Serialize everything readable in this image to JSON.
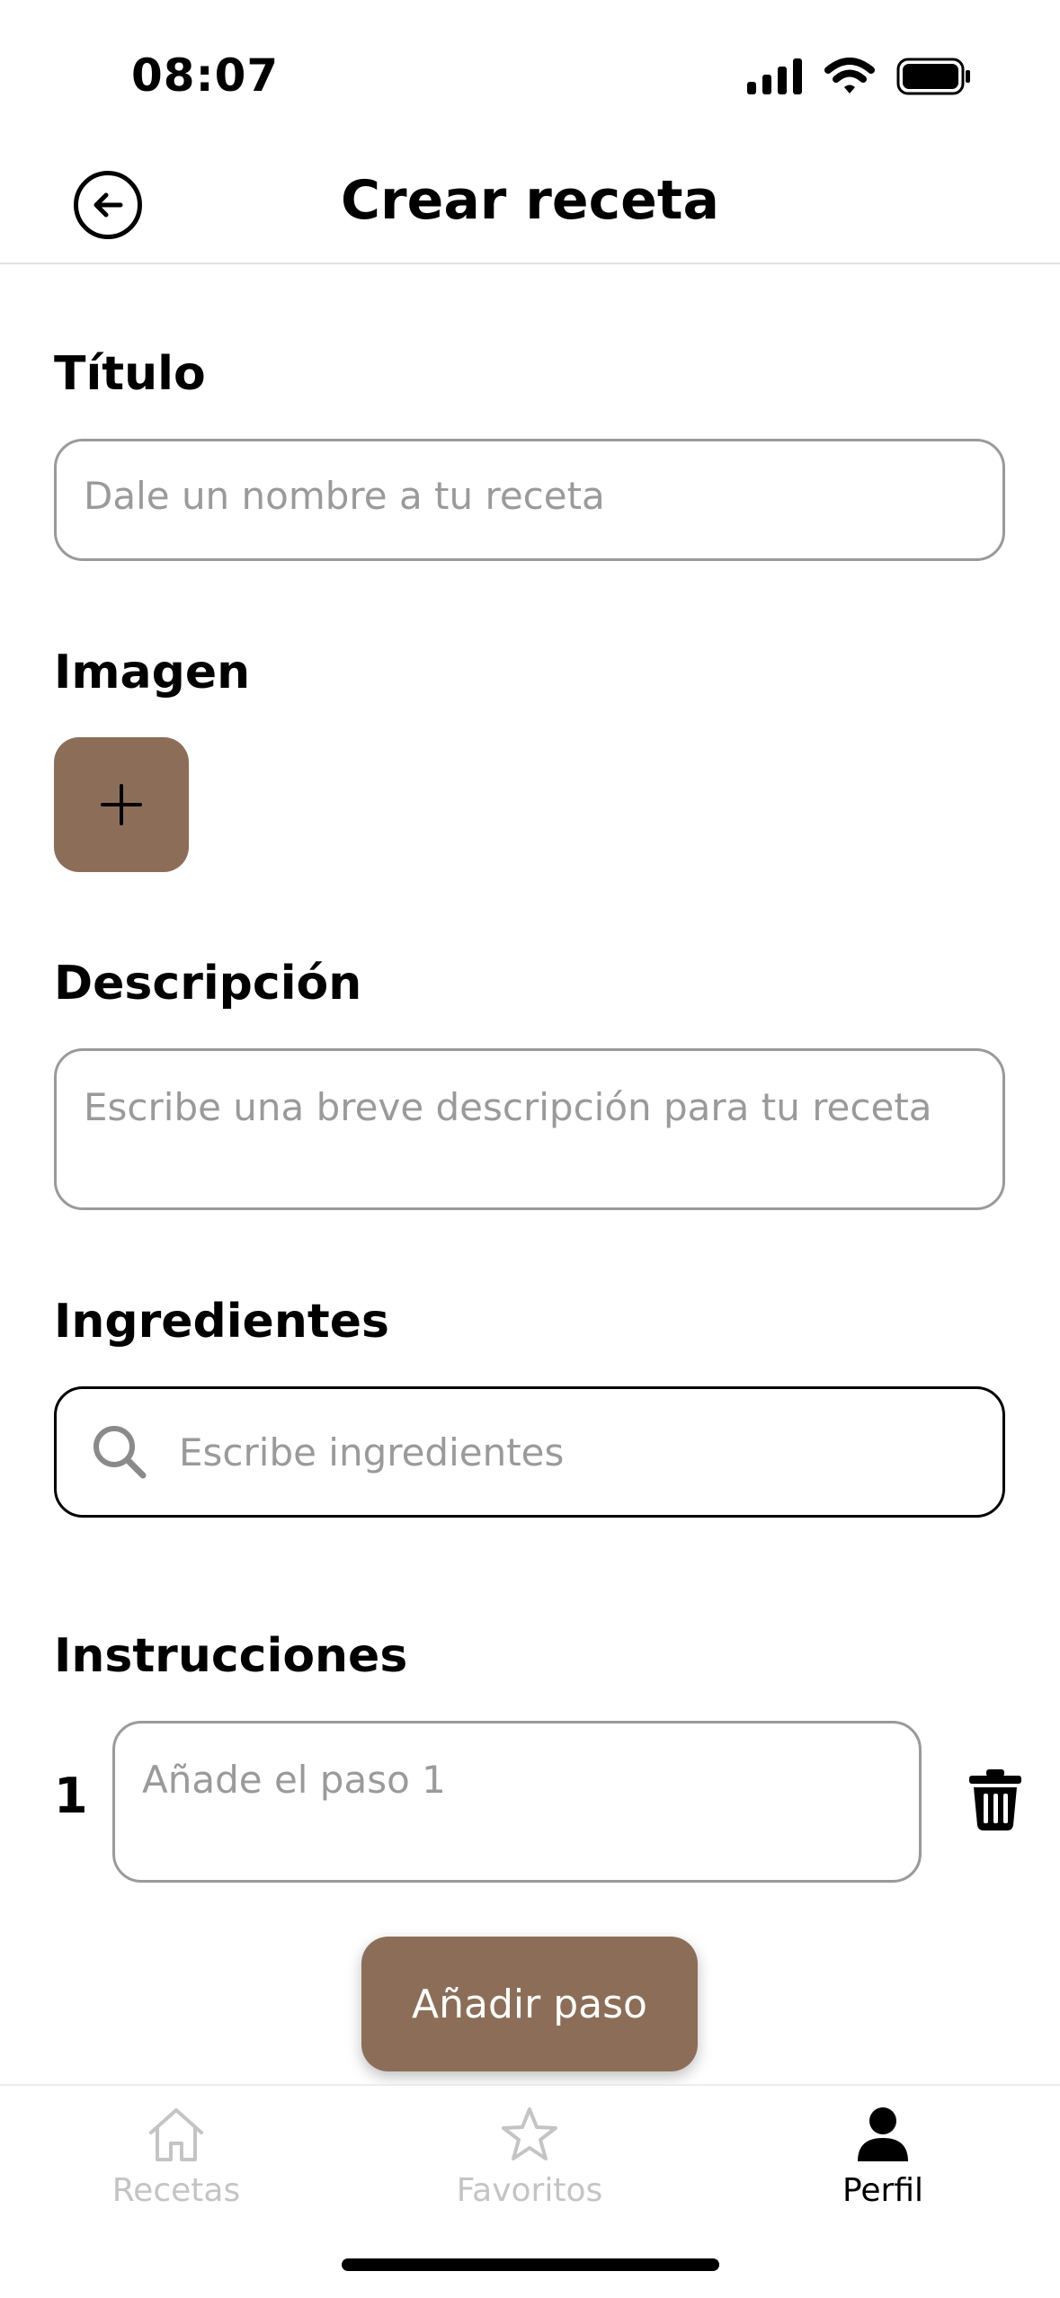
{
  "status_bar": {
    "time": "08:07",
    "icons": [
      "cellular-icon",
      "wifi-icon",
      "battery-icon"
    ]
  },
  "header": {
    "title": "Crear receta",
    "back_icon": "back-arrow-circle-icon"
  },
  "form": {
    "title": {
      "label": "Título",
      "placeholder": "Dale un nombre a tu receta"
    },
    "image": {
      "label": "Imagen",
      "add_icon": "plus-icon"
    },
    "description": {
      "label": "Descripción",
      "placeholder": "Escribe una breve descripción para tu receta"
    },
    "ingredients": {
      "label": "Ingredientes",
      "placeholder": "Escribe ingredientes",
      "icon": "search-icon"
    },
    "instructions": {
      "label": "Instrucciones",
      "steps": [
        {
          "number": "1",
          "placeholder": "Añade el paso 1"
        }
      ],
      "delete_icon": "trash-icon",
      "add_step_label": "Añadir paso"
    }
  },
  "tabbar": {
    "tabs": [
      {
        "label": "Recetas",
        "icon": "home-icon",
        "active": false
      },
      {
        "label": "Favoritos",
        "icon": "star-icon",
        "active": false
      },
      {
        "label": "Perfil",
        "icon": "person-icon",
        "active": true
      }
    ]
  },
  "colors": {
    "accent": "#8c6e58",
    "inactive": "#c4c4c4",
    "placeholder": "#9a9a9a"
  }
}
